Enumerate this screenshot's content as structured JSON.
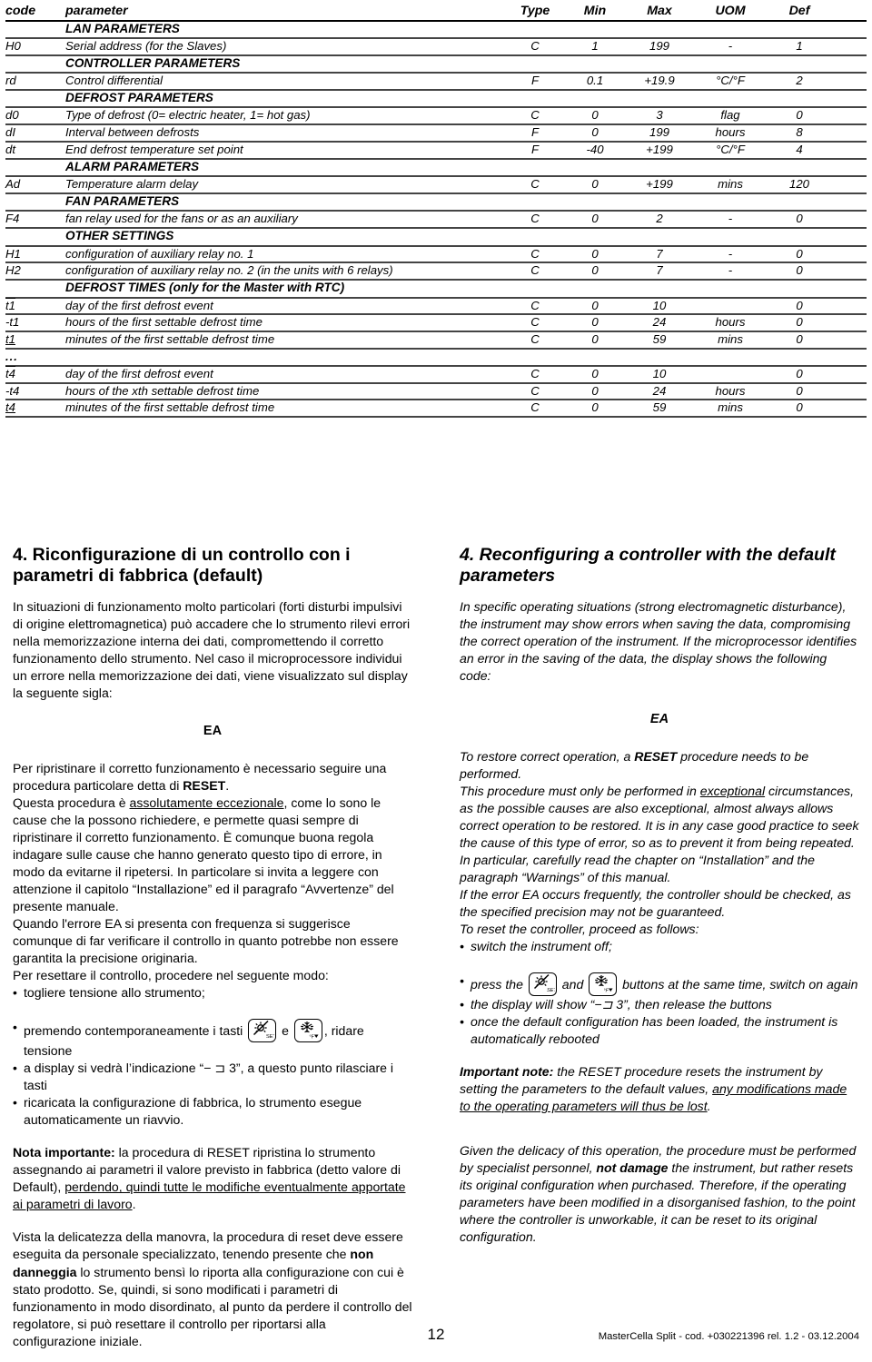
{
  "table": {
    "headers": {
      "code": "code",
      "parameter": "parameter",
      "type": "Type",
      "min": "Min",
      "max": "Max",
      "uom": "UOM",
      "def": "Def"
    },
    "rows": [
      {
        "kind": "section",
        "title": "LAN PARAMETERS"
      },
      {
        "kind": "data",
        "code": "H0",
        "code_style": "plain",
        "parameter": "Serial address (for the Slaves)",
        "type": "C",
        "min": "1",
        "max": "199",
        "uom": "-",
        "def": "1"
      },
      {
        "kind": "section",
        "title": "CONTROLLER PARAMETERS"
      },
      {
        "kind": "data",
        "code": "rd",
        "code_style": "plain",
        "parameter": "Control differential",
        "type": "F",
        "min": "0.1",
        "max": "+19.9",
        "uom": "°C/°F",
        "def": "2"
      },
      {
        "kind": "section",
        "title": "DEFROST PARAMETERS"
      },
      {
        "kind": "data",
        "code": "d0",
        "code_style": "plain",
        "parameter": "Type of defrost (0= electric heater, 1= hot gas)",
        "type": "C",
        "min": "0",
        "max": "3",
        "uom": "flag",
        "def": "0"
      },
      {
        "kind": "data",
        "code": "dI",
        "code_style": "plain",
        "parameter": "Interval between defrosts",
        "type": "F",
        "min": "0",
        "max": "199",
        "uom": "hours",
        "def": "8"
      },
      {
        "kind": "data",
        "code": "dt",
        "code_style": "plain",
        "parameter": "End defrost temperature set point",
        "type": "F",
        "min": "-40",
        "max": "+199",
        "uom": "°C/°F",
        "def": "4"
      },
      {
        "kind": "section",
        "title": "ALARM PARAMETERS"
      },
      {
        "kind": "data",
        "code": "Ad",
        "code_style": "plain",
        "parameter": "Temperature alarm delay",
        "type": "C",
        "min": "0",
        "max": "+199",
        "uom": "mins",
        "def": "120"
      },
      {
        "kind": "section",
        "title": "FAN PARAMETERS"
      },
      {
        "kind": "data",
        "code": "F4",
        "code_style": "plain",
        "parameter": "fan relay used for the fans or as an auxiliary",
        "type": "C",
        "min": "0",
        "max": "2",
        "uom": "-",
        "def": "0"
      },
      {
        "kind": "section",
        "title": "OTHER SETTINGS"
      },
      {
        "kind": "data",
        "code": "H1",
        "code_style": "plain",
        "parameter": "configuration of auxiliary relay no. 1",
        "type": "C",
        "min": "0",
        "max": "7",
        "uom": "-",
        "def": "0"
      },
      {
        "kind": "data",
        "code": "H2",
        "code_style": "plain",
        "parameter": "configuration of auxiliary relay no. 2 (in the units with 6 relays)",
        "type": "C",
        "min": "0",
        "max": "7",
        "uom": "-",
        "def": "0"
      },
      {
        "kind": "section",
        "title": "DEFROST TIMES  (only for the Master with RTC)"
      },
      {
        "kind": "data",
        "code": "t1",
        "code_style": "overline",
        "parameter": "day of the first defrost event",
        "type": "C",
        "min": "0",
        "max": "10",
        "uom": "",
        "def": "0"
      },
      {
        "kind": "data",
        "code": "-t1",
        "code_style": "plain",
        "parameter": "hours of the first settable defrost time",
        "type": "C",
        "min": "0",
        "max": "24",
        "uom": "hours",
        "def": "0"
      },
      {
        "kind": "data",
        "code": "t1",
        "code_style": "underline",
        "parameter": "minutes of the first settable defrost time",
        "type": "C",
        "min": "0",
        "max": "59",
        "uom": "mins",
        "def": "0"
      },
      {
        "kind": "ellipsis",
        "title": "..."
      },
      {
        "kind": "data",
        "code": "t4",
        "code_style": "overline",
        "parameter": "day of the first defrost event",
        "type": "C",
        "min": "0",
        "max": "10",
        "uom": "",
        "def": "0"
      },
      {
        "kind": "data",
        "code": "-t4",
        "code_style": "plain",
        "parameter": "hours of the xth settable defrost time",
        "type": "C",
        "min": "0",
        "max": "24",
        "uom": "hours",
        "def": "0"
      },
      {
        "kind": "data",
        "code": "t4",
        "code_style": "underline",
        "parameter": "minutes of the first settable defrost time",
        "type": "C",
        "min": "0",
        "max": "59",
        "uom": "mins",
        "def": "0"
      }
    ]
  },
  "italian": {
    "heading": "4. Riconfigurazione di un controllo con i parametri di fabbrica (default)",
    "intro": "In situazioni di funzionamento molto particolari (forti disturbi impulsivi di origine elettromagnetica) può accadere che lo strumento rilevi errori nella memorizzazione interna dei dati, compromettendo il corretto funzionamento dello strumento. Nel caso il microprocessore individui un errore nella memorizzazione dei dati, viene visualizzato sul display la seguente sigla:",
    "error_code": "EA",
    "p2_a": "Per ripristinare il corretto funzionamento è necessario seguire una procedura particolare detta di ",
    "p2_reset": "RESET",
    "p2_b": ".",
    "p3_a": "Questa procedura è ",
    "p3_u": "assolutamente eccezionale",
    "p3_b": ", come lo sono le cause che la possono richiedere, e permette quasi sempre di ripristinare il corretto funzionamento. È comunque buona regola indagare sulle cause che hanno generato questo tipo di errore, in modo da evitarne il ripetersi. In particolare si invita a leggere con attenzione il capitolo “Installazione” ed il paragrafo “Avvertenze” del presente manuale.",
    "p4": "Quando l'errore EA si presenta con frequenza si suggerisce comunque di far verificare il controllo in quanto potrebbe non essere garantita la precisione originaria.",
    "p5": "Per resettare il controllo, procedere nel seguente modo:",
    "b1": "togliere tensione allo strumento;",
    "b2_a": "premendo contemporaneamente i tasti ",
    "b2_and": " e ",
    "b2_b": ", ridare tensione",
    "b3": "a display si vedrà l’indicazione “− ⊐ 3”, a questo punto rilasciare i tasti",
    "b4": "ricaricata la configurazione di fabbrica, lo strumento esegue",
    "b4_cont": "automaticamente un riavvio.",
    "note_label": "Nota importante:",
    "note_a": " la procedura di RESET ripristina lo strumento assegnando ai parametri il valore previsto in fabbrica (detto valore di Default), ",
    "note_u": "perdendo, quindi tutte le modifiche eventualmente apportate ai parametri di lavoro",
    "note_b": ".",
    "last_a": "Vista la delicatezza della manovra, la procedura di reset deve essere eseguita da personale specializzato, tenendo presente che ",
    "last_strong1": "non danneggia",
    "last_b": " lo strumento bensì lo riporta alla configurazione con cui è stato prodotto. Se, quindi, si sono modificati i parametri di funzionamento in modo disordinato, al punto da perdere il controllo del regolatore, si può resettare il controllo per riportarsi alla configurazione iniziale."
  },
  "english": {
    "heading": "4. Reconfiguring a controller with the default parameters",
    "intro": "In specific operating situations (strong electromagnetic disturbance), the instrument may show errors when saving the data, compromising the correct operation of the instrument. If the microprocessor identifies an error in the saving of the data, the display shows the following code:",
    "error_code": "EA",
    "p2_a": "To restore correct operation, a ",
    "p2_reset": "RESET",
    "p2_b": " procedure needs to be performed.",
    "p3_a": "This procedure must only be performed in ",
    "p3_u": "exceptional",
    "p3_b": " circumstances, as the possible causes are also exceptional, almost always allows correct operation to be restored. It is in any case good practice to seek the cause of this type of error, so as to prevent it from being repeated. In particular, carefully read the chapter on “Installation” and the paragraph “Warnings” of this manual.",
    "p4": "If the error EA occurs frequently, the controller should be checked, as the specified precision may not be guaranteed.",
    "p5": "To reset the controller, proceed as follows:",
    "b1": "switch the instrument off;",
    "b2_a": "press the ",
    "b2_and": " and ",
    "b2_b": " buttons at the same time, switch on again",
    "b3": "the display will show “−⊐ 3”, then release the buttons",
    "b4": "once the default configuration has been loaded, the instrument is",
    "b4_cont": "automatically rebooted",
    "note_label": "Important note:",
    "note_a": " the RESET procedure resets the instrument by setting the parameters to the default values, ",
    "note_u": "any modifications made to the operating parameters will thus be lost",
    "note_b": ".",
    "last_a": "Given the delicacy of this operation, the procedure must be performed by specialist personnel, ",
    "last_strong1": "not damage",
    "last_b": " the instrument, but rather resets its original configuration when purchased. Therefore, if the operating parameters have been modified in a disorganised fashion, to the point where the controller is unworkable, it can be reset to its original configuration."
  },
  "footer": {
    "page_number": "12",
    "reference": "MasterCella Split - cod. +030221396  rel. 1.2 - 03.12.2004"
  },
  "icons": {
    "set_key": "light-set-key-icon",
    "defrost_key": "defrost-snowflake-key-icon"
  }
}
